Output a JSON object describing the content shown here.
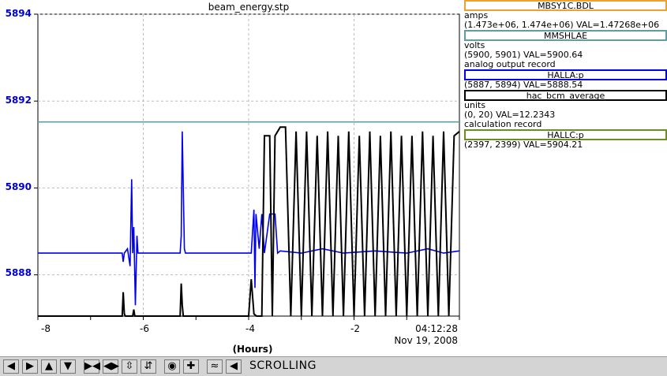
{
  "chart_data": {
    "type": "line",
    "title": "beam_energy.stp",
    "xlabel": "(Hours)",
    "xlim": [
      -8,
      0
    ],
    "ylim": [
      5887.05,
      5894
    ],
    "x_ticks": [
      "-8",
      "-6",
      "-4",
      "-2"
    ],
    "y_ticks": [
      "5894",
      "5892",
      "5890",
      "5888"
    ],
    "end_time": "04:12:28",
    "end_date": "Nov 19, 2008",
    "grid": true,
    "series": [
      {
        "name": "MMSHLAE",
        "color": "#5f9ea0",
        "x": [
          -8,
          0
        ],
        "y": [
          5891.52,
          5891.52
        ]
      },
      {
        "name": "HALLA:p",
        "color": "#0000ee",
        "x": [
          -8,
          -6.4,
          -6.38,
          -6.36,
          -6.3,
          -6.25,
          -6.22,
          -6.2,
          -6.18,
          -6.15,
          -6.12,
          -6.1,
          -6.08,
          -6.05,
          -5.3,
          -5.28,
          -5.26,
          -5.22,
          -5.2,
          -3.95,
          -3.9,
          -3.88,
          -3.86,
          -3.8,
          -3.75,
          -3.7,
          -3.6,
          -3.5,
          -3.45,
          -3.4,
          -3.0,
          -2.6,
          -2.2,
          -1.6,
          -1.0,
          -0.6,
          -0.3,
          0
        ],
        "y": [
          5888.5,
          5888.5,
          5888.3,
          5888.5,
          5888.6,
          5888.2,
          5890.2,
          5888.5,
          5889.1,
          5887.3,
          5888.9,
          5888.5,
          5888.5,
          5888.5,
          5888.5,
          5888.9,
          5891.3,
          5888.6,
          5888.5,
          5888.5,
          5889.5,
          5887.7,
          5889.4,
          5888.6,
          5889.4,
          5888.5,
          5889.4,
          5889.4,
          5888.5,
          5888.55,
          5888.5,
          5888.6,
          5888.5,
          5888.55,
          5888.5,
          5888.6,
          5888.5,
          5888.55
        ]
      },
      {
        "name": "hac_bcm_average",
        "color": "#000000",
        "x": [
          -8,
          -6.4,
          -6.38,
          -6.36,
          -6.34,
          -6.2,
          -6.18,
          -6.16,
          -5.3,
          -5.28,
          -5.26,
          -5.24,
          -4.0,
          -3.95,
          -3.9,
          -3.85,
          -3.75,
          -3.7,
          -3.6,
          -3.55,
          -3.5,
          -3.4,
          -3.3,
          -3.2,
          -3.1,
          -3.0,
          -2.9,
          -2.8,
          -2.7,
          -2.6,
          -2.5,
          -2.4,
          -2.3,
          -2.2,
          -2.1,
          -2.0,
          -1.9,
          -1.8,
          -1.7,
          -1.6,
          -1.5,
          -1.4,
          -1.3,
          -1.2,
          -1.1,
          -1.0,
          -0.9,
          -0.8,
          -0.7,
          -0.6,
          -0.5,
          -0.4,
          -0.3,
          -0.2,
          -0.1,
          0
        ],
        "y": [
          5887.05,
          5887.05,
          5887.6,
          5887.1,
          5887.05,
          5887.05,
          5887.2,
          5887.05,
          5887.05,
          5887.8,
          5887.3,
          5887.05,
          5887.05,
          5887.9,
          5887.1,
          5887.05,
          5887.05,
          5891.2,
          5891.2,
          5887.05,
          5891.2,
          5891.4,
          5891.4,
          5887.05,
          5891.3,
          5887.05,
          5891.3,
          5887.05,
          5891.2,
          5887.05,
          5891.3,
          5887.05,
          5891.2,
          5887.05,
          5891.3,
          5887.05,
          5891.2,
          5887.05,
          5891.3,
          5887.05,
          5891.2,
          5887.05,
          5891.3,
          5887.05,
          5891.2,
          5887.05,
          5891.2,
          5887.05,
          5891.3,
          5887.05,
          5891.2,
          5887.05,
          5891.3,
          5887.05,
          5891.2,
          5891.3
        ]
      }
    ]
  },
  "legend": [
    {
      "name": "MBSY1C.BDL",
      "color": "#f0a030",
      "lines": [
        "amps",
        "(1.473e+06, 1.474e+06) VAL=1.47268e+06"
      ]
    },
    {
      "name": "MMSHLAE",
      "color": "#5f9ea0",
      "lines": [
        "volts",
        "(5900, 5901) VAL=5900.64",
        "analog output record"
      ]
    },
    {
      "name": "HALLA:p",
      "color": "#0000ee",
      "lines": [
        "(5887, 5894) VAL=5888.54"
      ]
    },
    {
      "name": "hac_bcm_average",
      "color": "#000000",
      "lines": [
        "units",
        "(0, 20) VAL=12.2343",
        "calculation record"
      ]
    },
    {
      "name": "HALLC:p",
      "color": "#6b8e23",
      "lines": [
        "(2397, 2399) VAL=5904.21"
      ]
    }
  ],
  "toolbar": {
    "status": "SCROLLING",
    "buttons": [
      "arrow-right-icon",
      "arrow-right-icon",
      "arrow-up-icon",
      "arrow-down-icon",
      "zoom-in-h-icon",
      "zoom-out-h-icon",
      "zoom-in-v-icon",
      "zoom-out-v-icon",
      "stop-icon",
      "plus-icon",
      "autoscale-icon",
      "scroll-icon"
    ]
  }
}
